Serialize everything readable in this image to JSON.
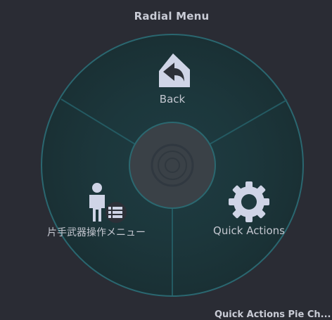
{
  "menu": {
    "title": "Radial Menu",
    "items": [
      {
        "label": "Back",
        "icon": "back-arrow-house-icon"
      },
      {
        "label": "片手武器操作メニュー",
        "icon": "person-list-icon"
      },
      {
        "label": "Quick Actions",
        "icon": "gear-icon"
      }
    ],
    "center_icon": "target-ring-icon"
  },
  "footer": {
    "text": "Quick Actions Pie Ch..."
  },
  "colors": {
    "background": "#2a2c34",
    "ring": "#1f3f44",
    "ring_border": "#2b6a72",
    "divider": "#255a62",
    "hub": "#3a4148",
    "icon": "#cfd4e6"
  }
}
